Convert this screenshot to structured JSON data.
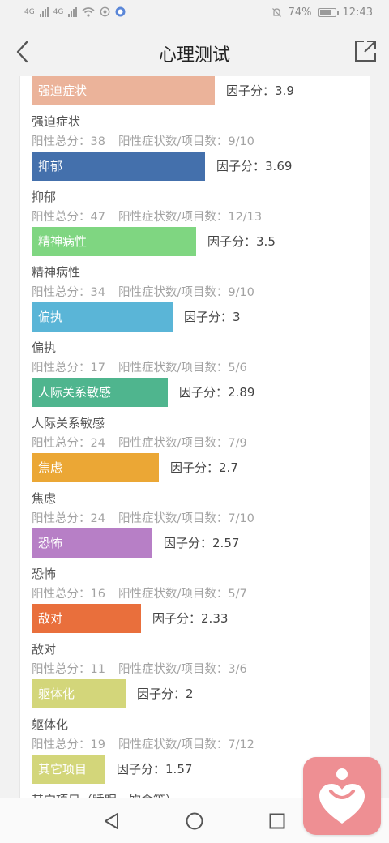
{
  "status_bar": {
    "network_1": "4G",
    "network_2": "4G",
    "battery_percent": "74%",
    "time": "12:43"
  },
  "header": {
    "title": "心理测试"
  },
  "labels": {
    "factor_label": "因子分：",
    "positive_total_label": "阳性总分：",
    "positive_items_label": "阳性症状数/项目数："
  },
  "items": [
    {
      "bar_label": "强迫症状",
      "name": "强迫症状",
      "factor": "3.9",
      "factor_value": 3.9,
      "total": "38",
      "items": "9/10",
      "color": "#ebb39a"
    },
    {
      "bar_label": "抑郁",
      "name": "抑郁",
      "factor": "3.69",
      "factor_value": 3.69,
      "total": "47",
      "items": "12/13",
      "color": "#4470ac"
    },
    {
      "bar_label": "精神病性",
      "name": "精神病性",
      "factor": "3.5",
      "factor_value": 3.5,
      "total": "34",
      "items": "9/10",
      "color": "#7fd681"
    },
    {
      "bar_label": "偏执",
      "name": "偏执",
      "factor": "3",
      "factor_value": 3,
      "total": "17",
      "items": "5/6",
      "color": "#5ab5d7"
    },
    {
      "bar_label": "人际关系敏感",
      "name": "人际关系敏感",
      "factor": "2.89",
      "factor_value": 2.89,
      "total": "24",
      "items": "7/9",
      "color": "#4fb58e"
    },
    {
      "bar_label": "焦虑",
      "name": "焦虑",
      "factor": "2.7",
      "factor_value": 2.7,
      "total": "24",
      "items": "7/10",
      "color": "#eba735"
    },
    {
      "bar_label": "恐怖",
      "name": "恐怖",
      "factor": "2.57",
      "factor_value": 2.57,
      "total": "16",
      "items": "5/7",
      "color": "#b77fc6"
    },
    {
      "bar_label": "敌对",
      "name": "敌对",
      "factor": "2.33",
      "factor_value": 2.33,
      "total": "11",
      "items": "3/6",
      "color": "#e96f3c"
    },
    {
      "bar_label": "躯体化",
      "name": "躯体化",
      "factor": "2",
      "factor_value": 2,
      "total": "19",
      "items": "7/12",
      "color": "#d3d67a"
    },
    {
      "bar_label": "其它项目",
      "name": "其它项目（睡眠、饮食等）",
      "factor": "1.57",
      "factor_value": 1.57,
      "total": "",
      "items": "",
      "color": "#d3d67a"
    }
  ],
  "icons": {
    "back": "back-arrow-icon",
    "share": "share-icon",
    "nav_back": "triangle-back-icon",
    "nav_home": "circle-home-icon",
    "nav_recent": "square-recent-icon",
    "fab": "heart-person-icon"
  },
  "colors": {
    "fab": "#ee8f93",
    "axis": "#cfcfcf"
  }
}
